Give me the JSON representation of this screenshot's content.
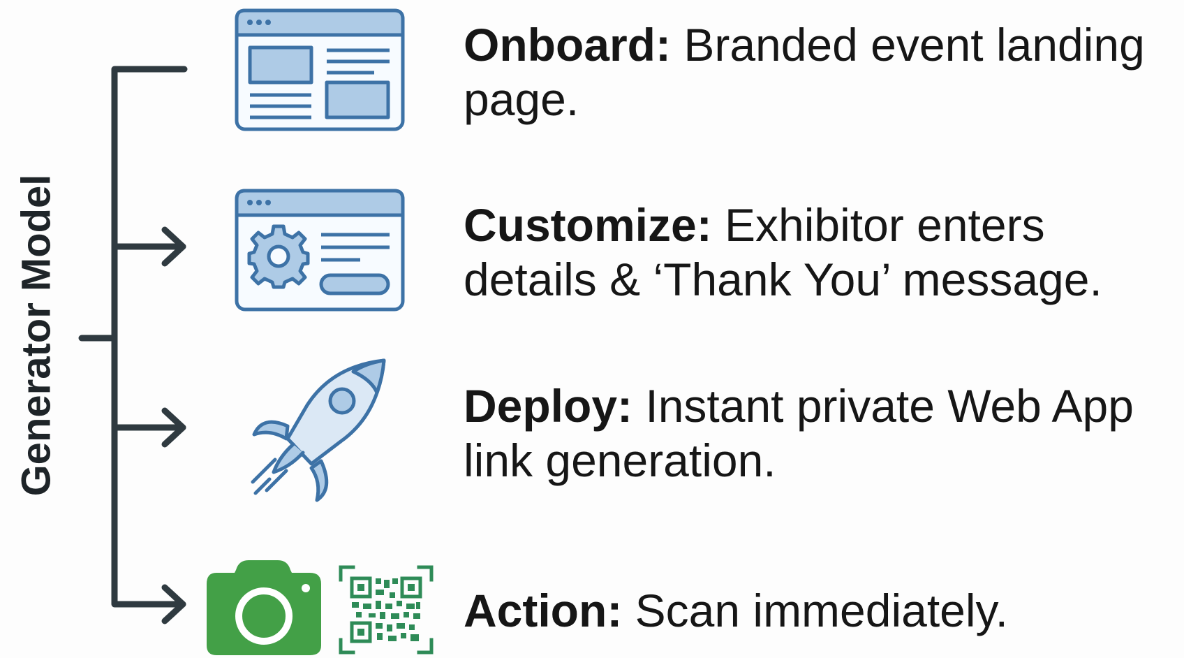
{
  "diagram": {
    "label": "Generator Model",
    "steps": [
      {
        "term": "Onboard:",
        "text": "Branded event landing page.",
        "icon": "landing-page-icon"
      },
      {
        "term": "Customize:",
        "text": "Exhibitor enters details & ‘Thank You’ message.",
        "icon": "settings-form-icon"
      },
      {
        "term": "Deploy:",
        "text": "Instant private Web App link generation.",
        "icon": "rocket-icon"
      },
      {
        "term": "Action:",
        "text": "Scan immediately.",
        "icon": "camera-qr-icon"
      }
    ],
    "colors": {
      "connector": "#2f3a40",
      "icon_stroke": "#3d72a6",
      "icon_fill": "#aecbe6",
      "camera_green": "#43a047",
      "qr_green": "#2e8b57"
    }
  }
}
